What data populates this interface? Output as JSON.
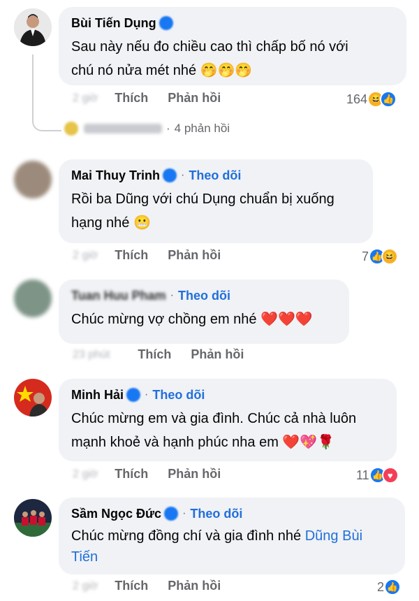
{
  "comments": [
    {
      "author": "Bùi Tiến Dụng",
      "follow": "",
      "text_lines": [
        "Sau này nếu đo chiều cao thì chấp bố nó với",
        "chú nó nửa mét nhé 🤭🤭🤭"
      ],
      "like_label": "Thích",
      "reply_label": "Phản hồi",
      "reaction_count": "164",
      "reactions": [
        "haha",
        "like"
      ]
    },
    {
      "author": "Mai Thuy Trinh",
      "follow": "Theo dõi",
      "text_lines": [
        "Rồi ba Dũng với chú Dụng chuẩn bị xuống",
        "hạng nhé 😬"
      ],
      "like_label": "Thích",
      "reply_label": "Phản hồi",
      "reaction_count": "7",
      "reactions": [
        "like",
        "haha"
      ]
    },
    {
      "author": "Tuan Huu Pham",
      "follow": "Theo dõi",
      "text_lines": [
        "Chúc mừng vợ chồng em nhé ❤️❤️❤️"
      ],
      "like_label": "Thích",
      "reply_label": "Phản hồi",
      "reaction_count": "",
      "reactions": []
    },
    {
      "author": "Minh Hải",
      "follow": "Theo dõi",
      "text_lines": [
        "Chúc mừng em và gia đình. Chúc cả nhà luôn",
        "mạnh khoẻ và hạnh phúc nha em ❤️💖🌹"
      ],
      "like_label": "Thích",
      "reply_label": "Phản hồi",
      "reaction_count": "11",
      "reactions": [
        "like",
        "love"
      ]
    },
    {
      "author": "Sầm Ngọc Đức",
      "follow": "Theo dõi",
      "text_lines": [
        "Chúc mừng đồng chí và gia đình nhé"
      ],
      "mention": "Dũng Bùi",
      "mention_cont": "Tiến",
      "like_label": "Thích",
      "reply_label": "Phản hồi",
      "reaction_count": "2",
      "reactions": [
        "like"
      ]
    }
  ],
  "replies_link": "4 phản hồi",
  "colors": {
    "accent": "#216fdb",
    "bubble": "#f0f2f5",
    "muted": "#65676b"
  },
  "icons": {
    "like": "thumbs-up-icon",
    "haha": "laughing-face-icon",
    "love": "heart-icon"
  }
}
